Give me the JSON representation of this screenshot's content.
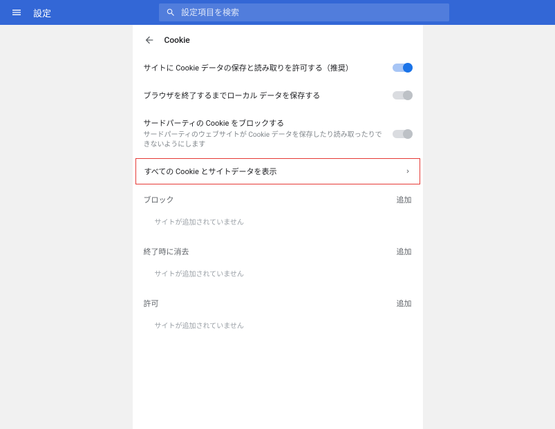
{
  "header": {
    "title": "設定",
    "search_placeholder": "設定項目を検索"
  },
  "panel": {
    "title": "Cookie"
  },
  "toggles": {
    "allow_save": {
      "label": "サイトに Cookie データの保存と読み取りを許可する（推奨）",
      "on": true
    },
    "until_close": {
      "label": "ブラウザを終了するまでローカル データを保存する",
      "on": false
    },
    "block_third": {
      "label": "サードパーティの Cookie をブロックする",
      "sub": "サードパーティのウェブサイトが Cookie データを保存したり読み取ったりできないようにします",
      "on": false
    }
  },
  "view_all": {
    "label": "すべての Cookie とサイトデータを表示"
  },
  "sections": {
    "block": {
      "title": "ブロック",
      "add": "追加",
      "empty": "サイトが追加されていません"
    },
    "clear_on_exit": {
      "title": "終了時に消去",
      "add": "追加",
      "empty": "サイトが追加されていません"
    },
    "allow": {
      "title": "許可",
      "add": "追加",
      "empty": "サイトが追加されていません"
    }
  }
}
